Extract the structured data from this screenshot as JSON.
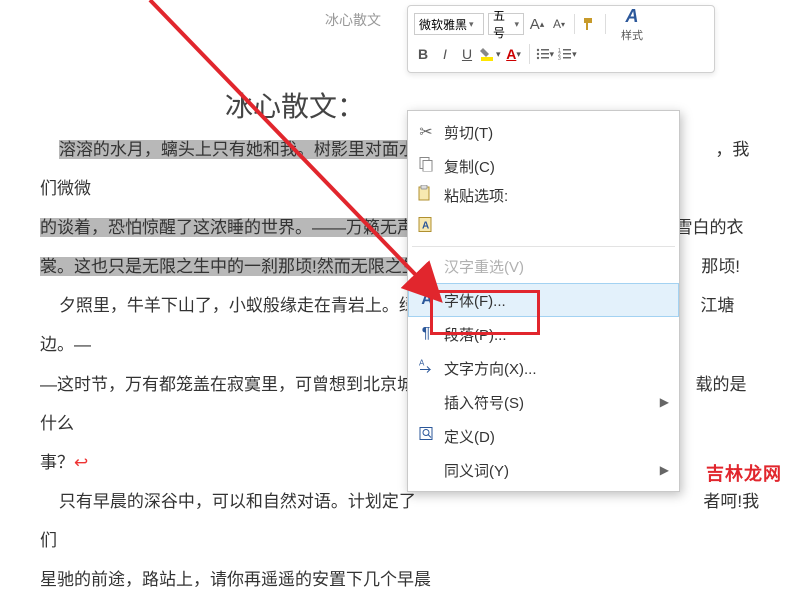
{
  "tab": {
    "label": "冰心散文"
  },
  "miniToolbar": {
    "fontName": "微软雅黑",
    "fontSize": "五号",
    "incFont": "A",
    "decFont": "A",
    "bold": "B",
    "italic": "I",
    "underline": "U",
    "stylesLabel": "样式"
  },
  "heading": "冰心散文：",
  "document": {
    "p1_sel": "溶溶的水月，螭头上只有她和我。树影里对面水",
    "p1_tail": "，我们微微",
    "p2_sel_a": "的谈着，恐怕惊醒了这浓睡的世界。——万籁无声，",
    "p2_tail": "龙雪白的衣",
    "p3_sel_a": "裳。这也只是无限之生中的一刹那顷!然而无限之生",
    "p3_tail": "那顷!",
    "p4_a": "夕照里，牛羊下山了，小蚁般缘走在青岩上。绿",
    "p4_b": "江塘边。—",
    "p5_a": "—这时节，万有都笼盖在寂寞里，可曾想到北京城里",
    "p5_b": "载的是什么",
    "p6": "事？",
    "p7_a": "只有早晨的深谷中，可以和自然对语。计划定了",
    "p7_b": "者呵!我们",
    "p8_a": "星驰的前途，路站上，请你再遥遥的安置下几个早晨"
  },
  "contextMenu": {
    "cut": {
      "label": "剪切(T)"
    },
    "copy": {
      "label": "复制(C)"
    },
    "pasteHdr": {
      "label": "粘贴选项:"
    },
    "ime": {
      "label": "汉字重选(V)"
    },
    "font": {
      "label": "字体(F)..."
    },
    "para": {
      "label": "段落(P)..."
    },
    "textdir": {
      "label": "文字方向(X)..."
    },
    "symbol": {
      "label": "插入符号(S)"
    },
    "define": {
      "label": "定义(D)"
    },
    "synonym": {
      "label": "同义词(Y)"
    }
  },
  "watermark": "吉林龙网"
}
